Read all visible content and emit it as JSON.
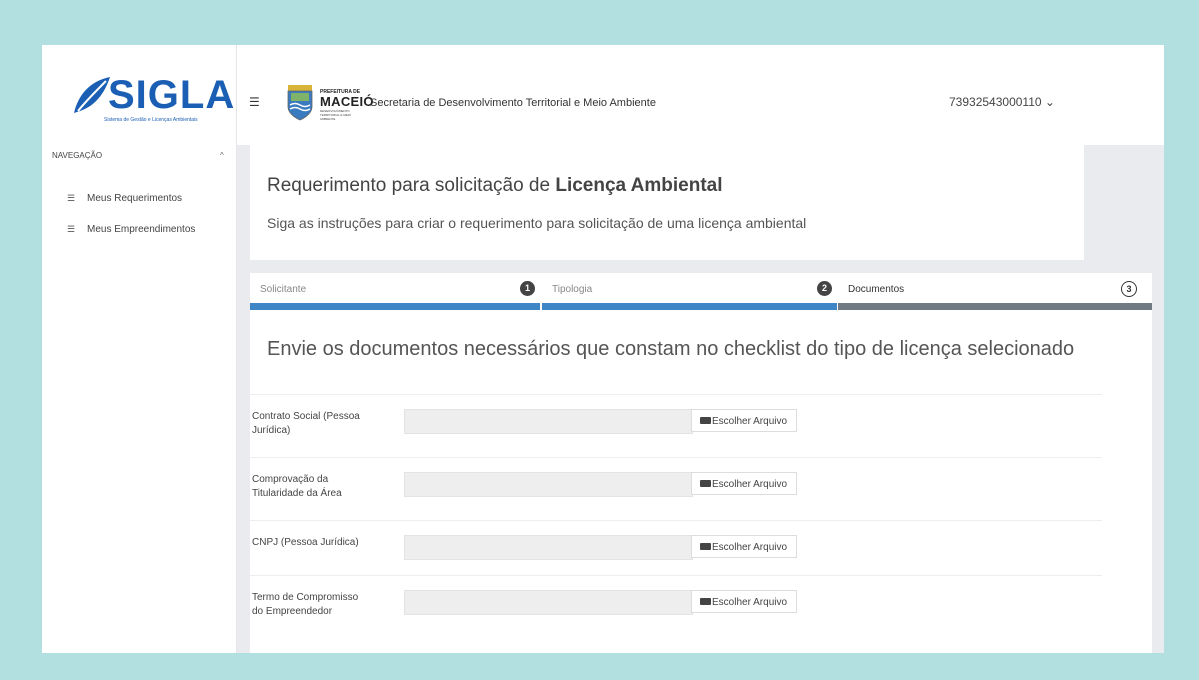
{
  "header": {
    "logo_text": "SIGLA",
    "logo_subtitle": "Sistema de Gestão e Licenças Ambientais",
    "prefeitura_top": "PREFEITURA DE",
    "prefeitura_city": "MACEIÓ",
    "prefeitura_bottom": "DESENVOLVIMENTO TERRITORIAL E MEIO AMBIENTE",
    "secretaria": "Secretaria de Desenvolvimento Territorial e Meio Ambiente",
    "user_id": "73932543000110 ⌄"
  },
  "sidebar": {
    "title": "NAVEGAÇÃO",
    "collapse_glyph": "^",
    "items": [
      {
        "label": "Meus Requerimentos",
        "icon": "list-icon"
      },
      {
        "label": "Meus Empreendimentos",
        "icon": "list-icon"
      }
    ]
  },
  "main": {
    "title_prefix": "Requerimento para solicitação de",
    "title_bold": "Licença Ambiental",
    "subtitle": "Siga as instruções para criar o requerimento para solicitação de uma licença ambiental",
    "steps": [
      {
        "label": "Solicitante",
        "number": "1",
        "completed": true
      },
      {
        "label": "Tipologia",
        "number": "2",
        "completed": true
      },
      {
        "label": "Documentos",
        "number": "3",
        "completed": false
      }
    ],
    "section_title": "Envie os documentos necessários que constam no checklist do tipo de licença selecionado",
    "documents": [
      {
        "label": "Contrato Social (Pessoa Jurídica)",
        "button": "Escolher Arquivo"
      },
      {
        "label": "Comprovação da Titularidade da Área",
        "button": "Escolher Arquivo"
      },
      {
        "label": "CNPJ (Pessoa Jurídica)",
        "button": "Escolher Arquivo"
      },
      {
        "label": "Termo de Compromisso do Empreendedor",
        "button": "Escolher Arquivo"
      }
    ]
  },
  "colors": {
    "background": "#b2dfe0",
    "brand_blue": "#1b5fb5",
    "step_done": "#3f86c6",
    "step_pending": "#6f7a82"
  }
}
